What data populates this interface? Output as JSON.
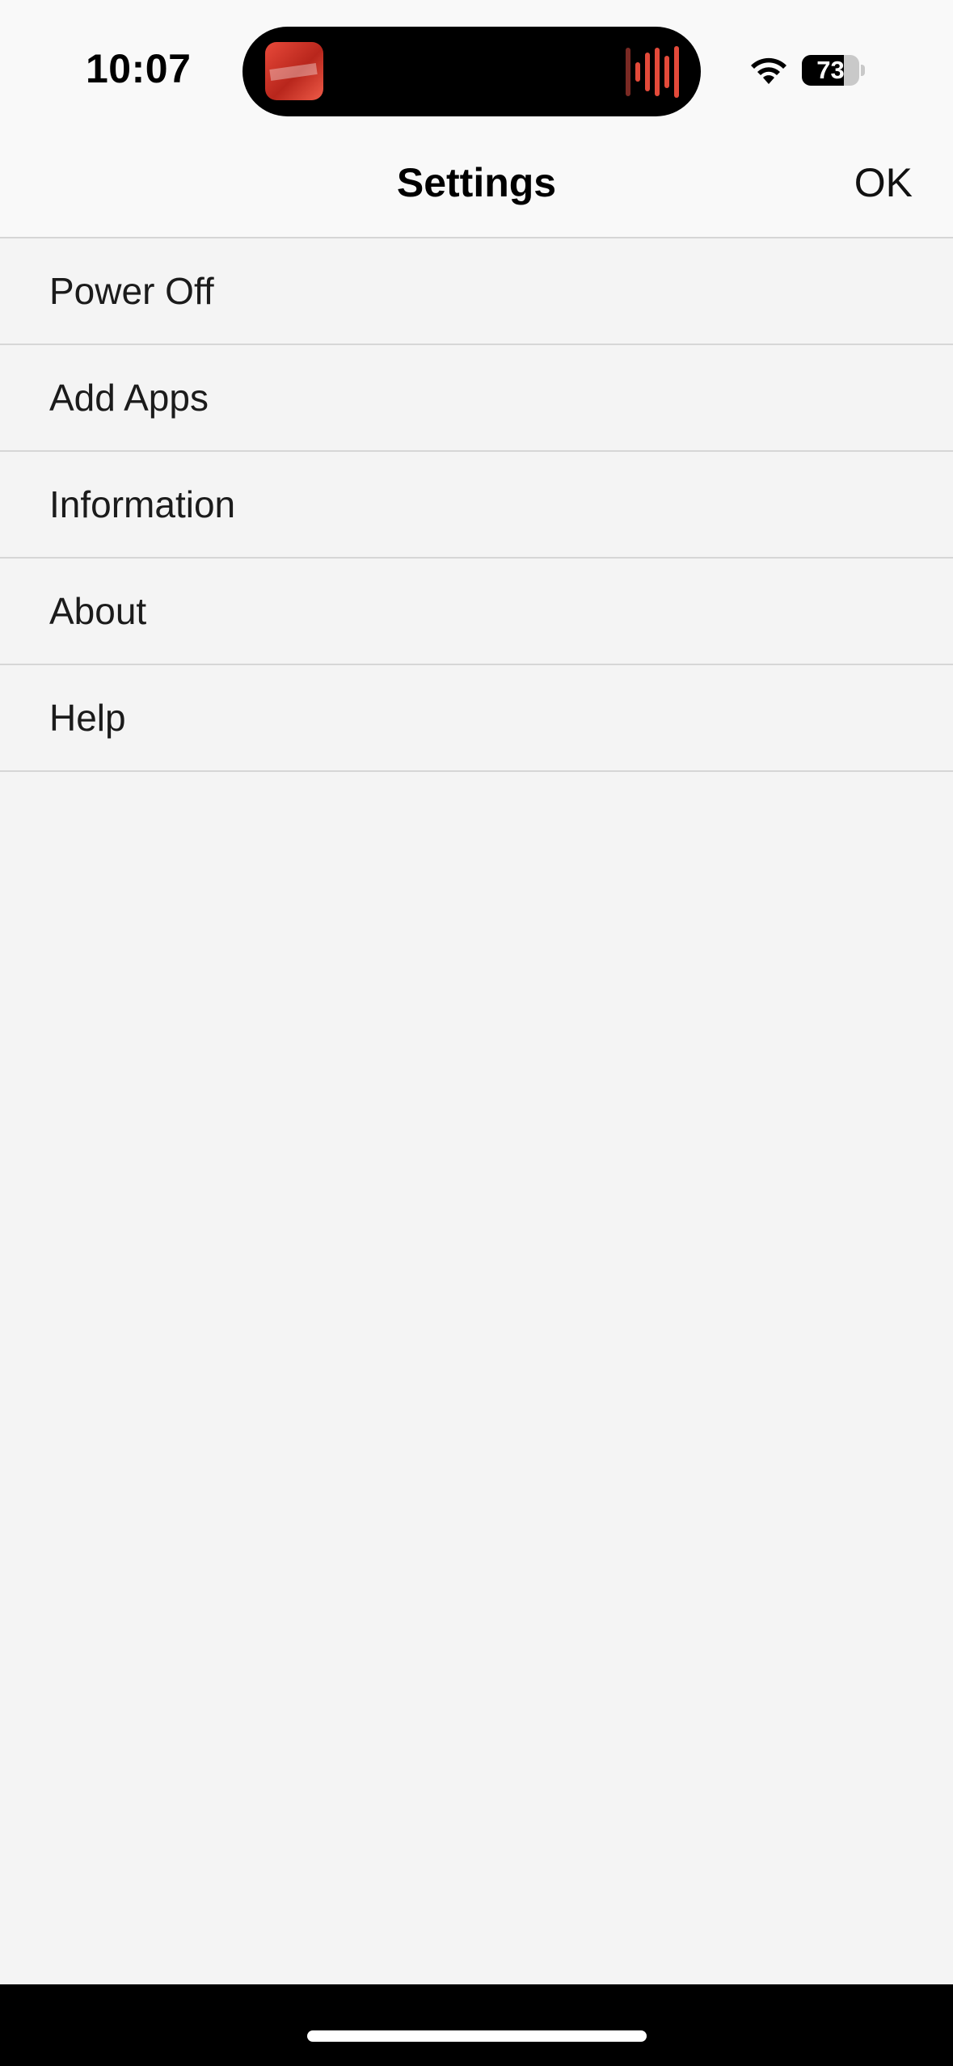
{
  "status_bar": {
    "time": "10:07",
    "battery_level": "73",
    "battery_fraction": 0.73,
    "icons": [
      "wifi-icon",
      "battery-icon"
    ]
  },
  "dynamic_island": {
    "icons": [
      "album-art-icon",
      "audio-waveform-icon"
    ],
    "accent_color": "#e34a3a"
  },
  "nav_bar": {
    "title": "Settings",
    "ok_label": "OK"
  },
  "menu": {
    "items": [
      {
        "label": "Power Off"
      },
      {
        "label": "Add Apps"
      },
      {
        "label": "Information"
      },
      {
        "label": "About"
      },
      {
        "label": "Help"
      }
    ]
  },
  "colors": {
    "background": "#f4f4f4",
    "header_background": "#f9f9f9",
    "divider": "#d6d6d6",
    "bottom_bar": "#000000"
  }
}
